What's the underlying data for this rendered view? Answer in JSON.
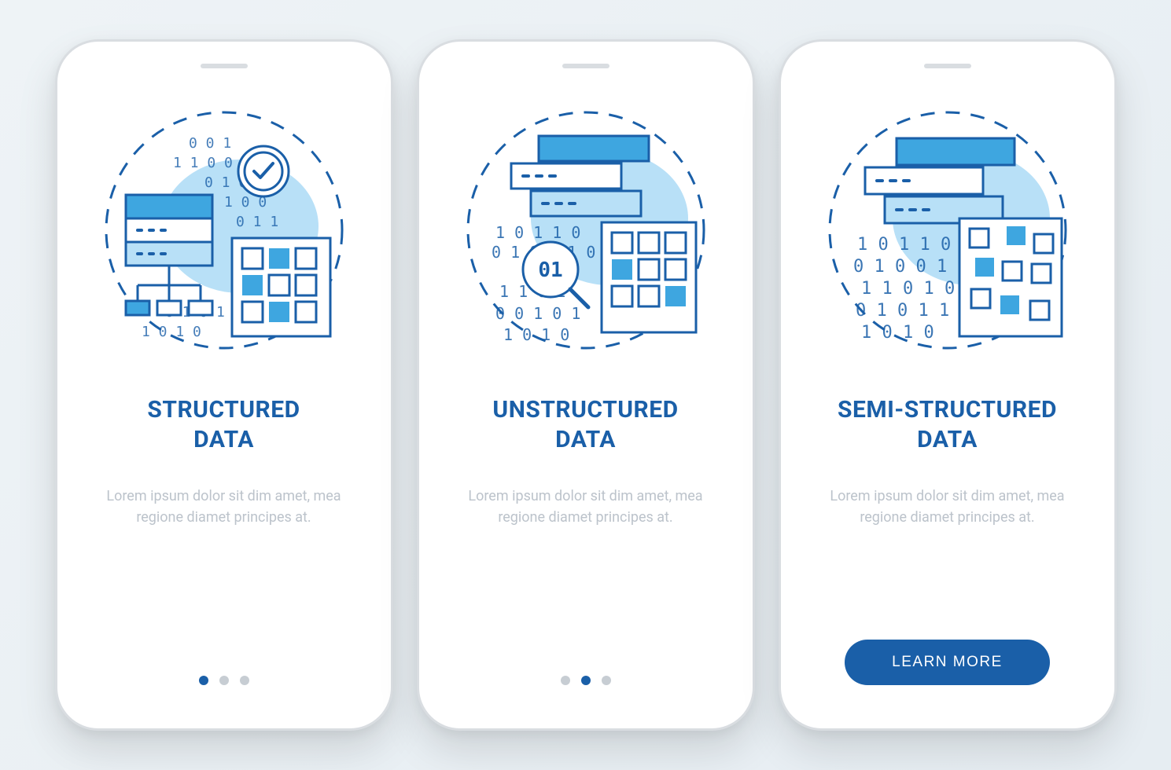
{
  "colors": {
    "primary": "#1a5fa8",
    "accent": "#3ea6e0",
    "light": "#b8e0f7",
    "dot_inactive": "#c7cdd3",
    "text_muted": "#bcc3cb"
  },
  "screens": [
    {
      "id": "structured",
      "icon": "structured-data-icon",
      "title": "STRUCTURED\nDATA",
      "description": "Lorem ipsum dolor sit dim amet, mea regione diamet principes at.",
      "pagination": {
        "total": 3,
        "active": 0
      },
      "cta": null
    },
    {
      "id": "unstructured",
      "icon": "unstructured-data-icon",
      "title": "UNSTRUCTURED\nDATA",
      "description": "Lorem ipsum dolor sit dim amet, mea regione diamet principes at.",
      "pagination": {
        "total": 3,
        "active": 1
      },
      "cta": null
    },
    {
      "id": "semi",
      "icon": "semi-structured-data-icon",
      "title": "SEMI-STRUCTURED\nDATA",
      "description": "Lorem ipsum dolor sit dim amet, mea regione diamet principes at.",
      "pagination": null,
      "cta": "LEARN MORE"
    }
  ]
}
